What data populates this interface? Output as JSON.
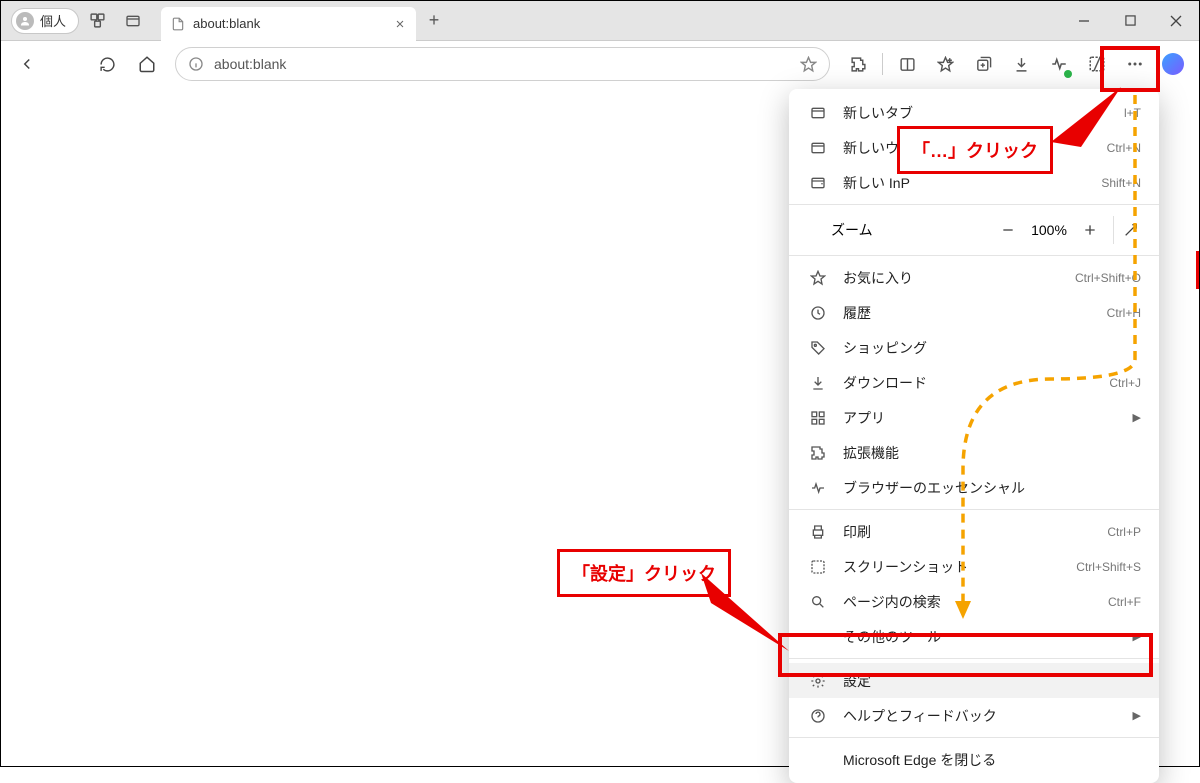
{
  "titlebar": {
    "profile": "個人",
    "tab_title": "about:blank"
  },
  "toolbar": {
    "url": "about:blank"
  },
  "menu": {
    "new_tab": {
      "label": "新しいタブ",
      "shortcut": "l+T"
    },
    "new_window": {
      "label": "新しいウィ",
      "shortcut": "Ctrl+N"
    },
    "new_inprivate": {
      "label": "新しい InP",
      "shortcut": "Shift+N"
    },
    "zoom": {
      "label": "ズーム",
      "value": "100%"
    },
    "favorites": {
      "label": "お気に入り",
      "shortcut": "Ctrl+Shift+O"
    },
    "history": {
      "label": "履歴",
      "shortcut": "Ctrl+H"
    },
    "shopping": {
      "label": "ショッピング"
    },
    "downloads": {
      "label": "ダウンロード",
      "shortcut": "Ctrl+J"
    },
    "apps": {
      "label": "アプリ"
    },
    "extensions": {
      "label": "拡張機能"
    },
    "essentials": {
      "label": "ブラウザーのエッセンシャル"
    },
    "print": {
      "label": "印刷",
      "shortcut": "Ctrl+P"
    },
    "screenshot": {
      "label": "スクリーンショット",
      "shortcut": "Ctrl+Shift+S"
    },
    "find": {
      "label": "ページ内の検索",
      "shortcut": "Ctrl+F"
    },
    "more_tools": {
      "label": "その他のツール"
    },
    "settings": {
      "label": "設定"
    },
    "help": {
      "label": "ヘルプとフィードバック"
    },
    "close_edge": {
      "label": "Microsoft Edge を閉じる"
    }
  },
  "annotations": {
    "click_dots": "「…」クリック",
    "click_settings": "「設定」クリック"
  }
}
